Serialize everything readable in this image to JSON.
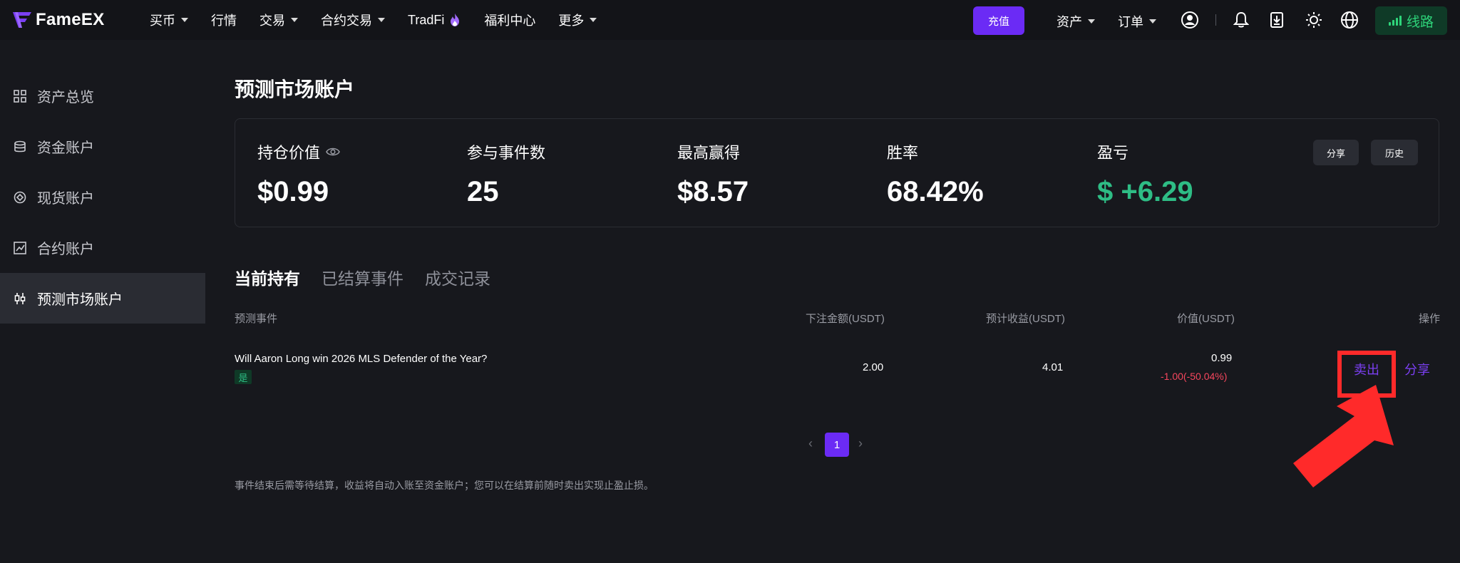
{
  "brand": {
    "name": "FameEX"
  },
  "nav": {
    "items": [
      {
        "label": "买币",
        "caret": true
      },
      {
        "label": "行情",
        "caret": false
      },
      {
        "label": "交易",
        "caret": true
      },
      {
        "label": "合约交易",
        "caret": true
      },
      {
        "label": "TradFi",
        "caret": false,
        "icon": "fire-icon"
      },
      {
        "label": "福利中心",
        "caret": false
      },
      {
        "label": "更多",
        "caret": true
      }
    ],
    "deposit_label": "充值",
    "assets_label": "资产",
    "orders_label": "订单",
    "line_label": "线路",
    "icons": [
      "user-icon",
      "bell-icon",
      "download-icon",
      "theme-sun-icon",
      "globe-icon"
    ]
  },
  "sidebar": {
    "items": [
      {
        "label": "资产总览",
        "icon": "grid-icon",
        "active": false
      },
      {
        "label": "资金账户",
        "icon": "database-icon",
        "active": false
      },
      {
        "label": "现货账户",
        "icon": "target-icon",
        "active": false
      },
      {
        "label": "合约账户",
        "icon": "chart-box-icon",
        "active": false
      },
      {
        "label": "预测市场账户",
        "icon": "candlestick-icon",
        "active": true
      }
    ]
  },
  "page": {
    "title": "预测市场账户"
  },
  "stats": {
    "holding": {
      "label": "持仓价值",
      "value": "$0.99"
    },
    "events": {
      "label": "参与事件数",
      "value": "25"
    },
    "max_win": {
      "label": "最高赢得",
      "value": "$8.57"
    },
    "win_rate": {
      "label": "胜率",
      "value": "68.42%"
    },
    "pnl": {
      "label": "盈亏",
      "value": "$ +6.29"
    },
    "share_label": "分享",
    "history_label": "历史"
  },
  "tabs": [
    {
      "label": "当前持有",
      "active": true
    },
    {
      "label": "已结算事件",
      "active": false
    },
    {
      "label": "成交记录",
      "active": false
    }
  ],
  "table": {
    "headers": {
      "event": "预测事件",
      "bet": "下注金额(USDT)",
      "expected": "预计收益(USDT)",
      "value": "价值(USDT)",
      "action": "操作"
    },
    "rows": [
      {
        "event": "Will Aaron Long win 2026 MLS Defender of the Year?",
        "side": "是",
        "bet": "2.00",
        "expected": "4.01",
        "value": "0.99",
        "change": "-1.00(-50.04%)",
        "sell_label": "卖出",
        "share_label": "分享"
      }
    ]
  },
  "pagination": {
    "current": "1",
    "prev": "‹",
    "next": "›"
  },
  "footnote": "事件结束后需等待结算，收益将自动入账至资金账户；您可以在结算前随时卖出实现止盈止损。",
  "colors": {
    "accent": "#6b2bf5",
    "green": "#2ebd85",
    "red": "#f6465d",
    "annotation": "#ff2a2a"
  }
}
